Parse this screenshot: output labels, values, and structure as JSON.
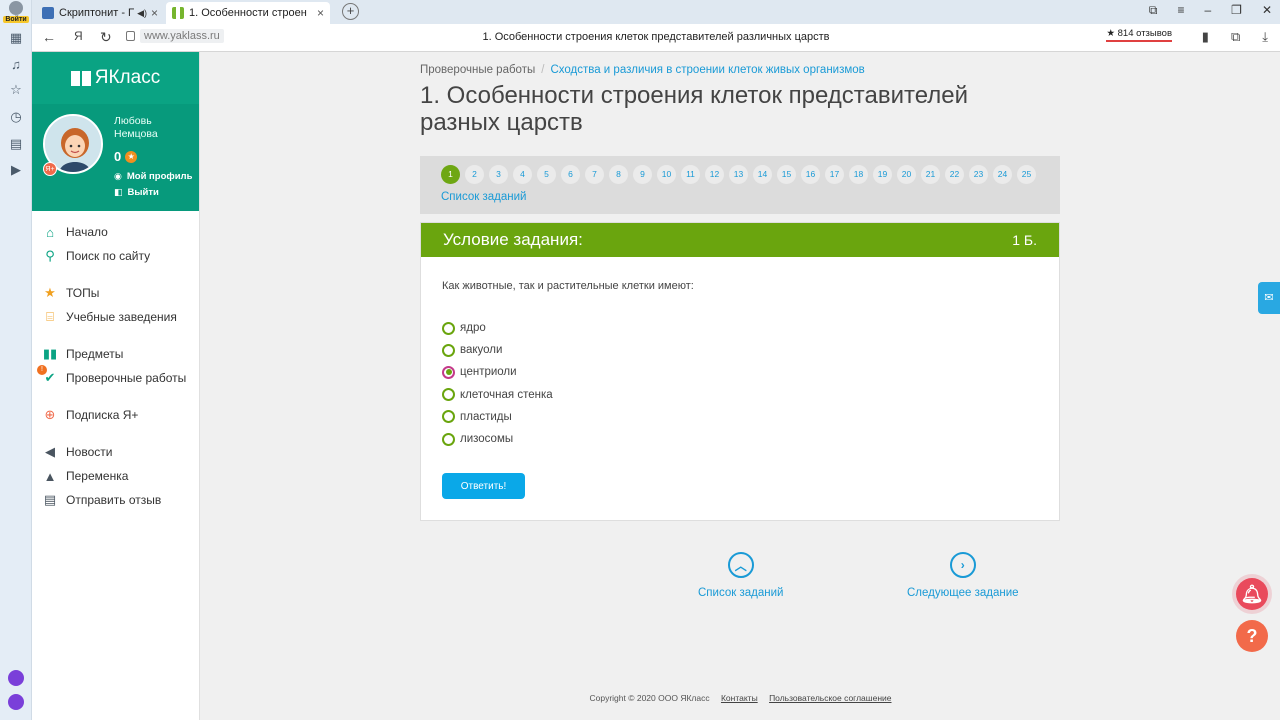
{
  "browser": {
    "login_label": "Войти",
    "tabs": [
      {
        "title": "Скриптонит - Поло"
      },
      {
        "title": "1. Особенности строен"
      }
    ],
    "url": "www.yaklass.ru",
    "page_title": "1. Особенности строения клеток представителей различных царств",
    "reviews": "★ 814 отзывов",
    "ya_label": "Я"
  },
  "sidebar": {
    "logo": "ЯКласс",
    "user": {
      "name": "Любовь Немцова",
      "points": "0",
      "profile_link": "Мой профиль",
      "logout_link": "Выйти"
    },
    "nav": [
      {
        "label": "Начало",
        "icon": "home-icon",
        "color": "#0aa383"
      },
      {
        "label": "Поиск по сайту",
        "icon": "search-icon",
        "color": "#0aa383"
      },
      {
        "label": "ТОПы",
        "icon": "star-icon",
        "color": "#f0a020"
      },
      {
        "label": "Учебные заведения",
        "icon": "institution-icon",
        "color": "#f0a020"
      },
      {
        "label": "Предметы",
        "icon": "books-icon",
        "color": "#0aa383"
      },
      {
        "label": "Проверочные работы",
        "icon": "check-icon",
        "color": "#0aa383",
        "badge": "!"
      },
      {
        "label": "Подписка Я+",
        "icon": "plus-icon",
        "color": "#f06a4a"
      },
      {
        "label": "Новости",
        "icon": "megaphone-icon",
        "color": "#4a5560"
      },
      {
        "label": "Переменка",
        "icon": "bell-icon",
        "color": "#4a5560"
      },
      {
        "label": "Отправить отзыв",
        "icon": "feedback-icon",
        "color": "#4a5560"
      }
    ]
  },
  "main": {
    "breadcrumb": {
      "root": "Проверочные работы",
      "separator": "/",
      "current": "Сходства и различия в строении клеток живых организмов"
    },
    "title": "1. Особенности строения клеток представителей разных царств",
    "task_numbers": [
      "1",
      "2",
      "3",
      "4",
      "5",
      "6",
      "7",
      "8",
      "9",
      "10",
      "11",
      "12",
      "13",
      "14",
      "15",
      "16",
      "17",
      "18",
      "19",
      "20",
      "21",
      "22",
      "23",
      "24",
      "25"
    ],
    "current_task": "1",
    "task_list_link": "Список заданий",
    "task": {
      "header": "Условие задания:",
      "score": "1 Б.",
      "question": "Как животные, так и растительные клетки имеют:",
      "options": [
        {
          "label": "ядро",
          "selected": false
        },
        {
          "label": "вакуоли",
          "selected": false
        },
        {
          "label": "центриоли",
          "selected": true
        },
        {
          "label": "клеточная стенка",
          "selected": false
        },
        {
          "label": "пластиды",
          "selected": false
        },
        {
          "label": "лизосомы",
          "selected": false
        }
      ],
      "submit_label": "Ответить!"
    },
    "bottom_nav": {
      "list_label": "Список заданий",
      "next_label": "Следующее задание"
    },
    "footer": {
      "copyright": "Copyright © 2020 ООО ЯКласс",
      "contacts": "Контакты",
      "agreement": "Пользовательское соглашение"
    }
  },
  "colors": {
    "brand_green": "#0aa383",
    "task_header": "#6aa50e",
    "link_blue": "#199ad6",
    "button_blue": "#0aa8e8"
  }
}
